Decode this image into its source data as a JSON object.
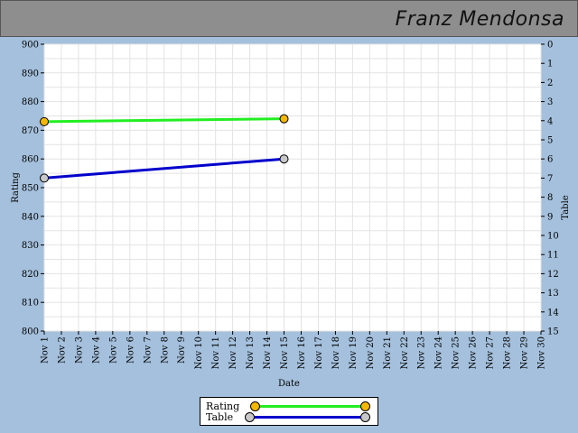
{
  "header": {
    "title": "Franz Mendonsa"
  },
  "chart_data": {
    "type": "line",
    "xlabel": "Date",
    "ylabel": "Rating",
    "y2label": "Table",
    "ylim": [
      800,
      900
    ],
    "y2lim": [
      0,
      15
    ],
    "y2_inverted": true,
    "yticks": [
      800,
      810,
      820,
      830,
      840,
      850,
      860,
      870,
      880,
      890,
      900
    ],
    "y2ticks": [
      0,
      1,
      2,
      3,
      4,
      5,
      6,
      7,
      8,
      9,
      10,
      11,
      12,
      13,
      14,
      15
    ],
    "categories": [
      "Nov 1",
      "Nov 2",
      "Nov 3",
      "Nov 4",
      "Nov 5",
      "Nov 6",
      "Nov 7",
      "Nov 8",
      "Nov 9",
      "Nov 10",
      "Nov 11",
      "Nov 12",
      "Nov 13",
      "Nov 14",
      "Nov 15",
      "Nov 16",
      "Nov 17",
      "Nov 18",
      "Nov 19",
      "Nov 20",
      "Nov 21",
      "Nov 22",
      "Nov 23",
      "Nov 24",
      "Nov 25",
      "Nov 26",
      "Nov 27",
      "Nov 28",
      "Nov 29",
      "Nov 30"
    ],
    "grid": true,
    "legend_position": "bottom-center",
    "series": [
      {
        "name": "Rating",
        "axis": "left",
        "color": "#22ee22",
        "marker_color": "#f5b800",
        "points": [
          {
            "x": "Nov 1",
            "y": 873
          },
          {
            "x": "Nov 15",
            "y": 874
          }
        ]
      },
      {
        "name": "Table",
        "axis": "right",
        "color": "#0000cc",
        "marker_color": "#c8c8c8",
        "points": [
          {
            "x": "Nov 1",
            "y": 7
          },
          {
            "x": "Nov 15",
            "y": 6
          }
        ]
      }
    ]
  }
}
